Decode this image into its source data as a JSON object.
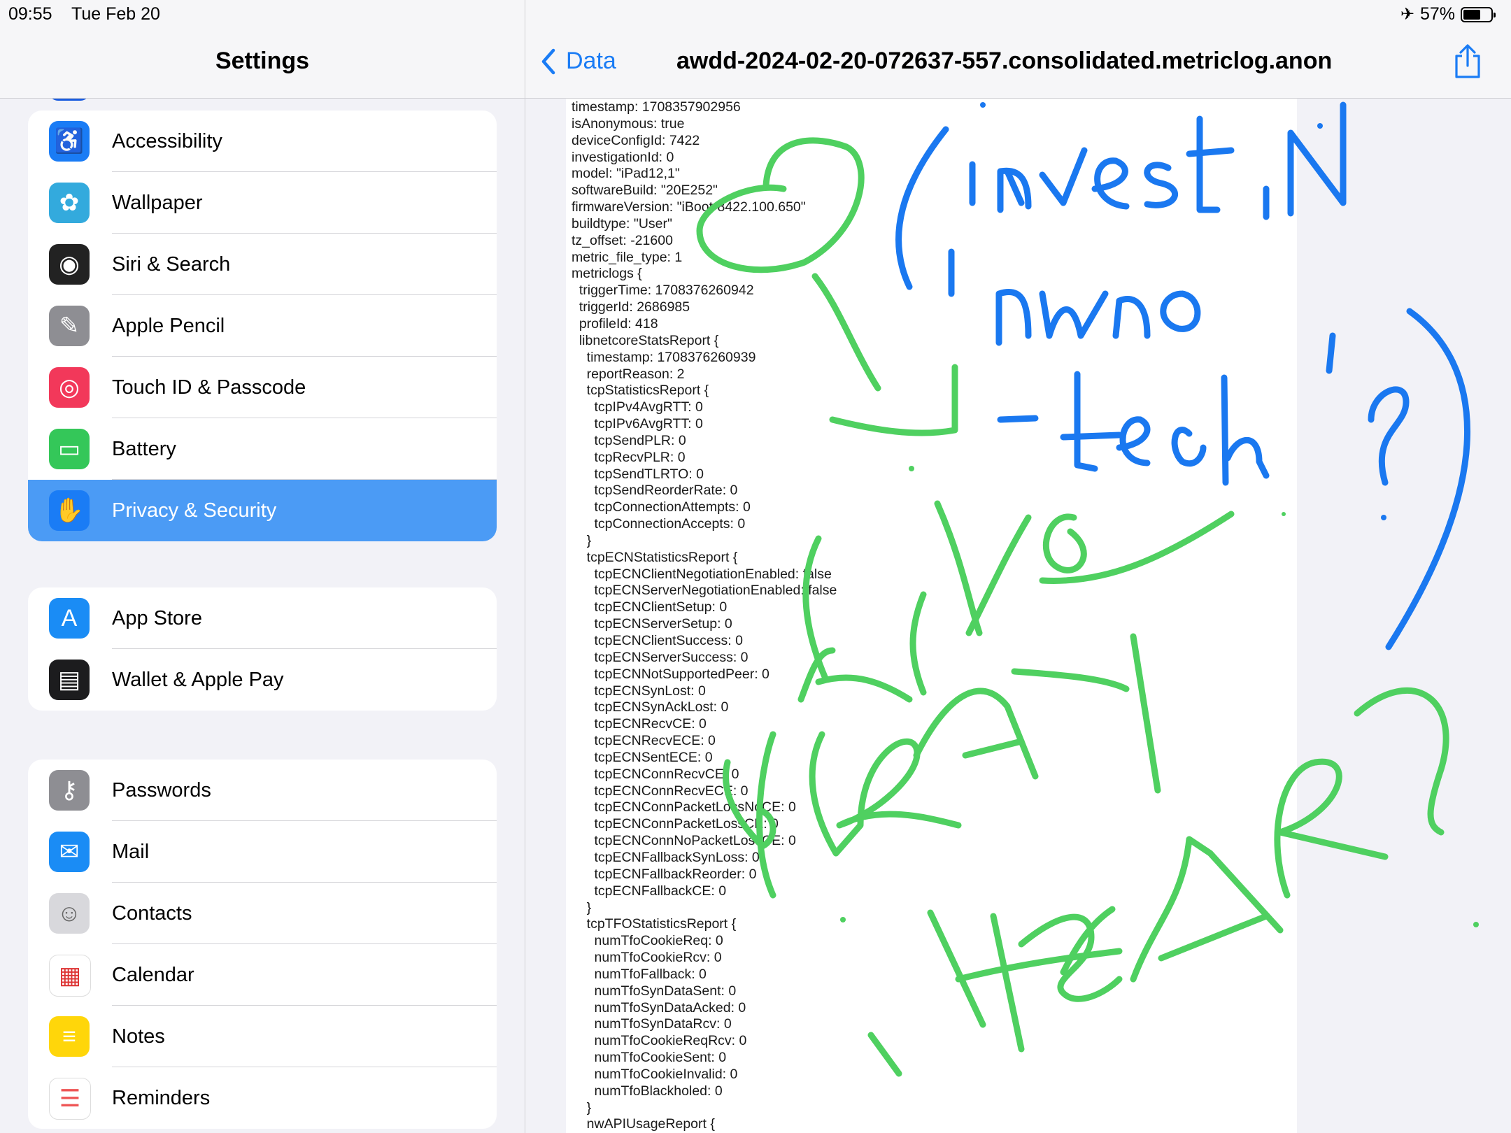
{
  "status_bar": {
    "time": "09:55",
    "date": "Tue Feb 20",
    "battery": "57%"
  },
  "sidebar": {
    "title": "Settings",
    "groups": [
      {
        "items": [
          {
            "label": "Accessibility",
            "icon": "accessibility-icon",
            "color": "#1a7cf5"
          },
          {
            "label": "Wallpaper",
            "icon": "wallpaper-icon",
            "color": "#33aadd"
          },
          {
            "label": "Siri & Search",
            "icon": "siri-icon",
            "color": "#222222"
          },
          {
            "label": "Apple Pencil",
            "icon": "pencil-icon",
            "color": "#8e8e93"
          },
          {
            "label": "Touch ID & Passcode",
            "icon": "fingerprint-icon",
            "color": "#f2385a"
          },
          {
            "label": "Battery",
            "icon": "battery-icon",
            "color": "#34c759"
          },
          {
            "label": "Privacy & Security",
            "icon": "hand-icon",
            "color": "#1a7cf5",
            "selected": true
          }
        ]
      },
      {
        "items": [
          {
            "label": "App Store",
            "icon": "app-store-icon",
            "color": "#1a8cf5"
          },
          {
            "label": "Wallet & Apple Pay",
            "icon": "wallet-icon",
            "color": "#1c1c1e"
          }
        ]
      },
      {
        "items": [
          {
            "label": "Passwords",
            "icon": "key-icon",
            "color": "#8e8e93"
          },
          {
            "label": "Mail",
            "icon": "mail-icon",
            "color": "#1a8cf5"
          },
          {
            "label": "Contacts",
            "icon": "contacts-icon",
            "color": "#d8d8dc"
          },
          {
            "label": "Calendar",
            "icon": "calendar-icon",
            "color": "#ffffff"
          },
          {
            "label": "Notes",
            "icon": "notes-icon",
            "color": "#ffd60a"
          },
          {
            "label": "Reminders",
            "icon": "reminders-icon",
            "color": "#ffffff"
          }
        ]
      }
    ]
  },
  "detail": {
    "back_label": "Data",
    "title": "awdd-2024-02-20-072637-557.consolidated.metriclog.anon",
    "log_lines": [
      "timestamp: 1708357902956",
      "isAnonymous: true",
      "deviceConfigId: 7422",
      "investigationId: 0",
      "model: \"iPad12,1\"",
      "softwareBuild: \"20E252\"",
      "firmwareVersion: \"iBoot-8422.100.650\"",
      "buildtype: \"User\"",
      "tz_offset: -21600",
      "metric_file_type: 1",
      "metriclogs {",
      "  triggerTime: 1708376260942",
      "  triggerId: 2686985",
      "  profileId: 418",
      "  libnetcoreStatsReport {",
      "    timestamp: 1708376260939",
      "    reportReason: 2",
      "    tcpStatisticsReport {",
      "      tcpIPv4AvgRTT: 0",
      "      tcpIPv6AvgRTT: 0",
      "      tcpSendPLR: 0",
      "      tcpRecvPLR: 0",
      "      tcpSendTLRTO: 0",
      "      tcpSendReorderRate: 0",
      "      tcpConnectionAttempts: 0",
      "      tcpConnectionAccepts: 0",
      "    }",
      "    tcpECNStatisticsReport {",
      "      tcpECNClientNegotiationEnabled: false",
      "      tcpECNServerNegotiationEnabled: false",
      "      tcpECNClientSetup: 0",
      "      tcpECNServerSetup: 0",
      "      tcpECNClientSuccess: 0",
      "      tcpECNServerSuccess: 0",
      "      tcpECNNotSupportedPeer: 0",
      "      tcpECNSynLost: 0",
      "      tcpECNSynAckLost: 0",
      "      tcpECNRecvCE: 0",
      "      tcpECNRecvECE: 0",
      "      tcpECNSentECE: 0",
      "      tcpECNConnRecvCE: 0",
      "      tcpECNConnRecvECE: 0",
      "      tcpECNConnPacketLossNoCE: 0",
      "      tcpECNConnPacketLossCE: 0",
      "      tcpECNConnNoPacketLossCE: 0",
      "      tcpECNFallbackSynLoss: 0",
      "      tcpECNFallbackReorder: 0",
      "      tcpECNFallbackCE: 0",
      "    }",
      "    tcpTFOStatisticsReport {",
      "      numTfoCookieReq: 0",
      "      numTfoCookieRcv: 0",
      "      numTfoFallback: 0",
      "      numTfoSynDataSent: 0",
      "      numTfoSynDataAcked: 0",
      "      numTfoSynDataRcv: 0",
      "      numTfoCookieReqRcv: 0",
      "      numTfoCookieSent: 0",
      "      numTfoCookieInvalid: 0",
      "      numTfoBlackholed: 0",
      "    }",
      "    nwAPIUsageReport {"
    ]
  },
  "colors": {
    "accent": "#1a7cf5",
    "selected_row": "#4b9bf5",
    "ink_blue": "#1a78f0",
    "ink_green": "#4fd060"
  }
}
